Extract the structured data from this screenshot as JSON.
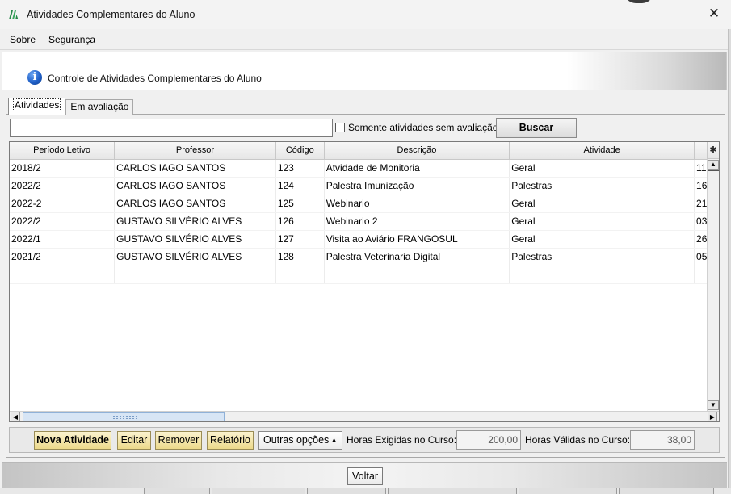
{
  "window": {
    "title": "Atividades Complementares do Aluno",
    "close_label": "✕"
  },
  "menu": {
    "items": [
      {
        "label": "Sobre"
      },
      {
        "label": "Segurança"
      }
    ]
  },
  "banner": {
    "info_glyph": "i",
    "title": "Controle de Atividades Complementares do Aluno"
  },
  "tabs": [
    {
      "label": "Atividades",
      "active": true
    },
    {
      "label": "Em avaliação",
      "active": false
    }
  ],
  "filter": {
    "search_value": "",
    "checkbox_label": "Somente atividades sem avaliação",
    "checkbox_checked": false,
    "search_button": "Buscar"
  },
  "grid": {
    "columns": [
      "Período Letivo",
      "Professor",
      "Código",
      "Descrição",
      "Atividade",
      ""
    ],
    "rows": [
      [
        "2018/2",
        "CARLOS IAGO SANTOS",
        "123",
        "Atvidade de Monitoria",
        "Geral",
        "11"
      ],
      [
        "2022/2",
        "CARLOS IAGO SANTOS",
        "124",
        "Palestra Imunização",
        "Palestras",
        "16"
      ],
      [
        "2022-2",
        "CARLOS IAGO SANTOS",
        "125",
        "Webinario",
        "Geral",
        "21"
      ],
      [
        "2022/2",
        "GUSTAVO SILVÉRIO ALVES",
        "126",
        "Webinario 2",
        "Geral",
        "03"
      ],
      [
        "2022/1",
        "GUSTAVO SILVÉRIO ALVES",
        "127",
        "Visita ao Aviário FRANGOSUL",
        "Geral",
        "26"
      ],
      [
        "2021/2",
        "GUSTAVO SILVÉRIO ALVES",
        "128",
        "Palestra Veterinaria Digital",
        "Palestras",
        "05"
      ],
      [
        "",
        "",
        "",
        "",
        "",
        ""
      ]
    ],
    "settings_glyph": "✱"
  },
  "toolbar": {
    "nova_atividade": "Nova Atividade",
    "editar": "Editar",
    "remover": "Remover",
    "relatorio": "Relatório",
    "outras_opcoes": "Outras opções",
    "horas_exigidas_label": "Horas Exigidas no Curso:",
    "horas_exigidas_value": "200,00",
    "horas_validas_label": "Horas Válidas no Curso:",
    "horas_validas_value": "38,00"
  },
  "footer": {
    "voltar": "Voltar"
  },
  "colors": {
    "action_button_bg": "#ecd98b",
    "info_icon": "#1f5fc7",
    "scroll_thumb": "#d7e5f5"
  }
}
